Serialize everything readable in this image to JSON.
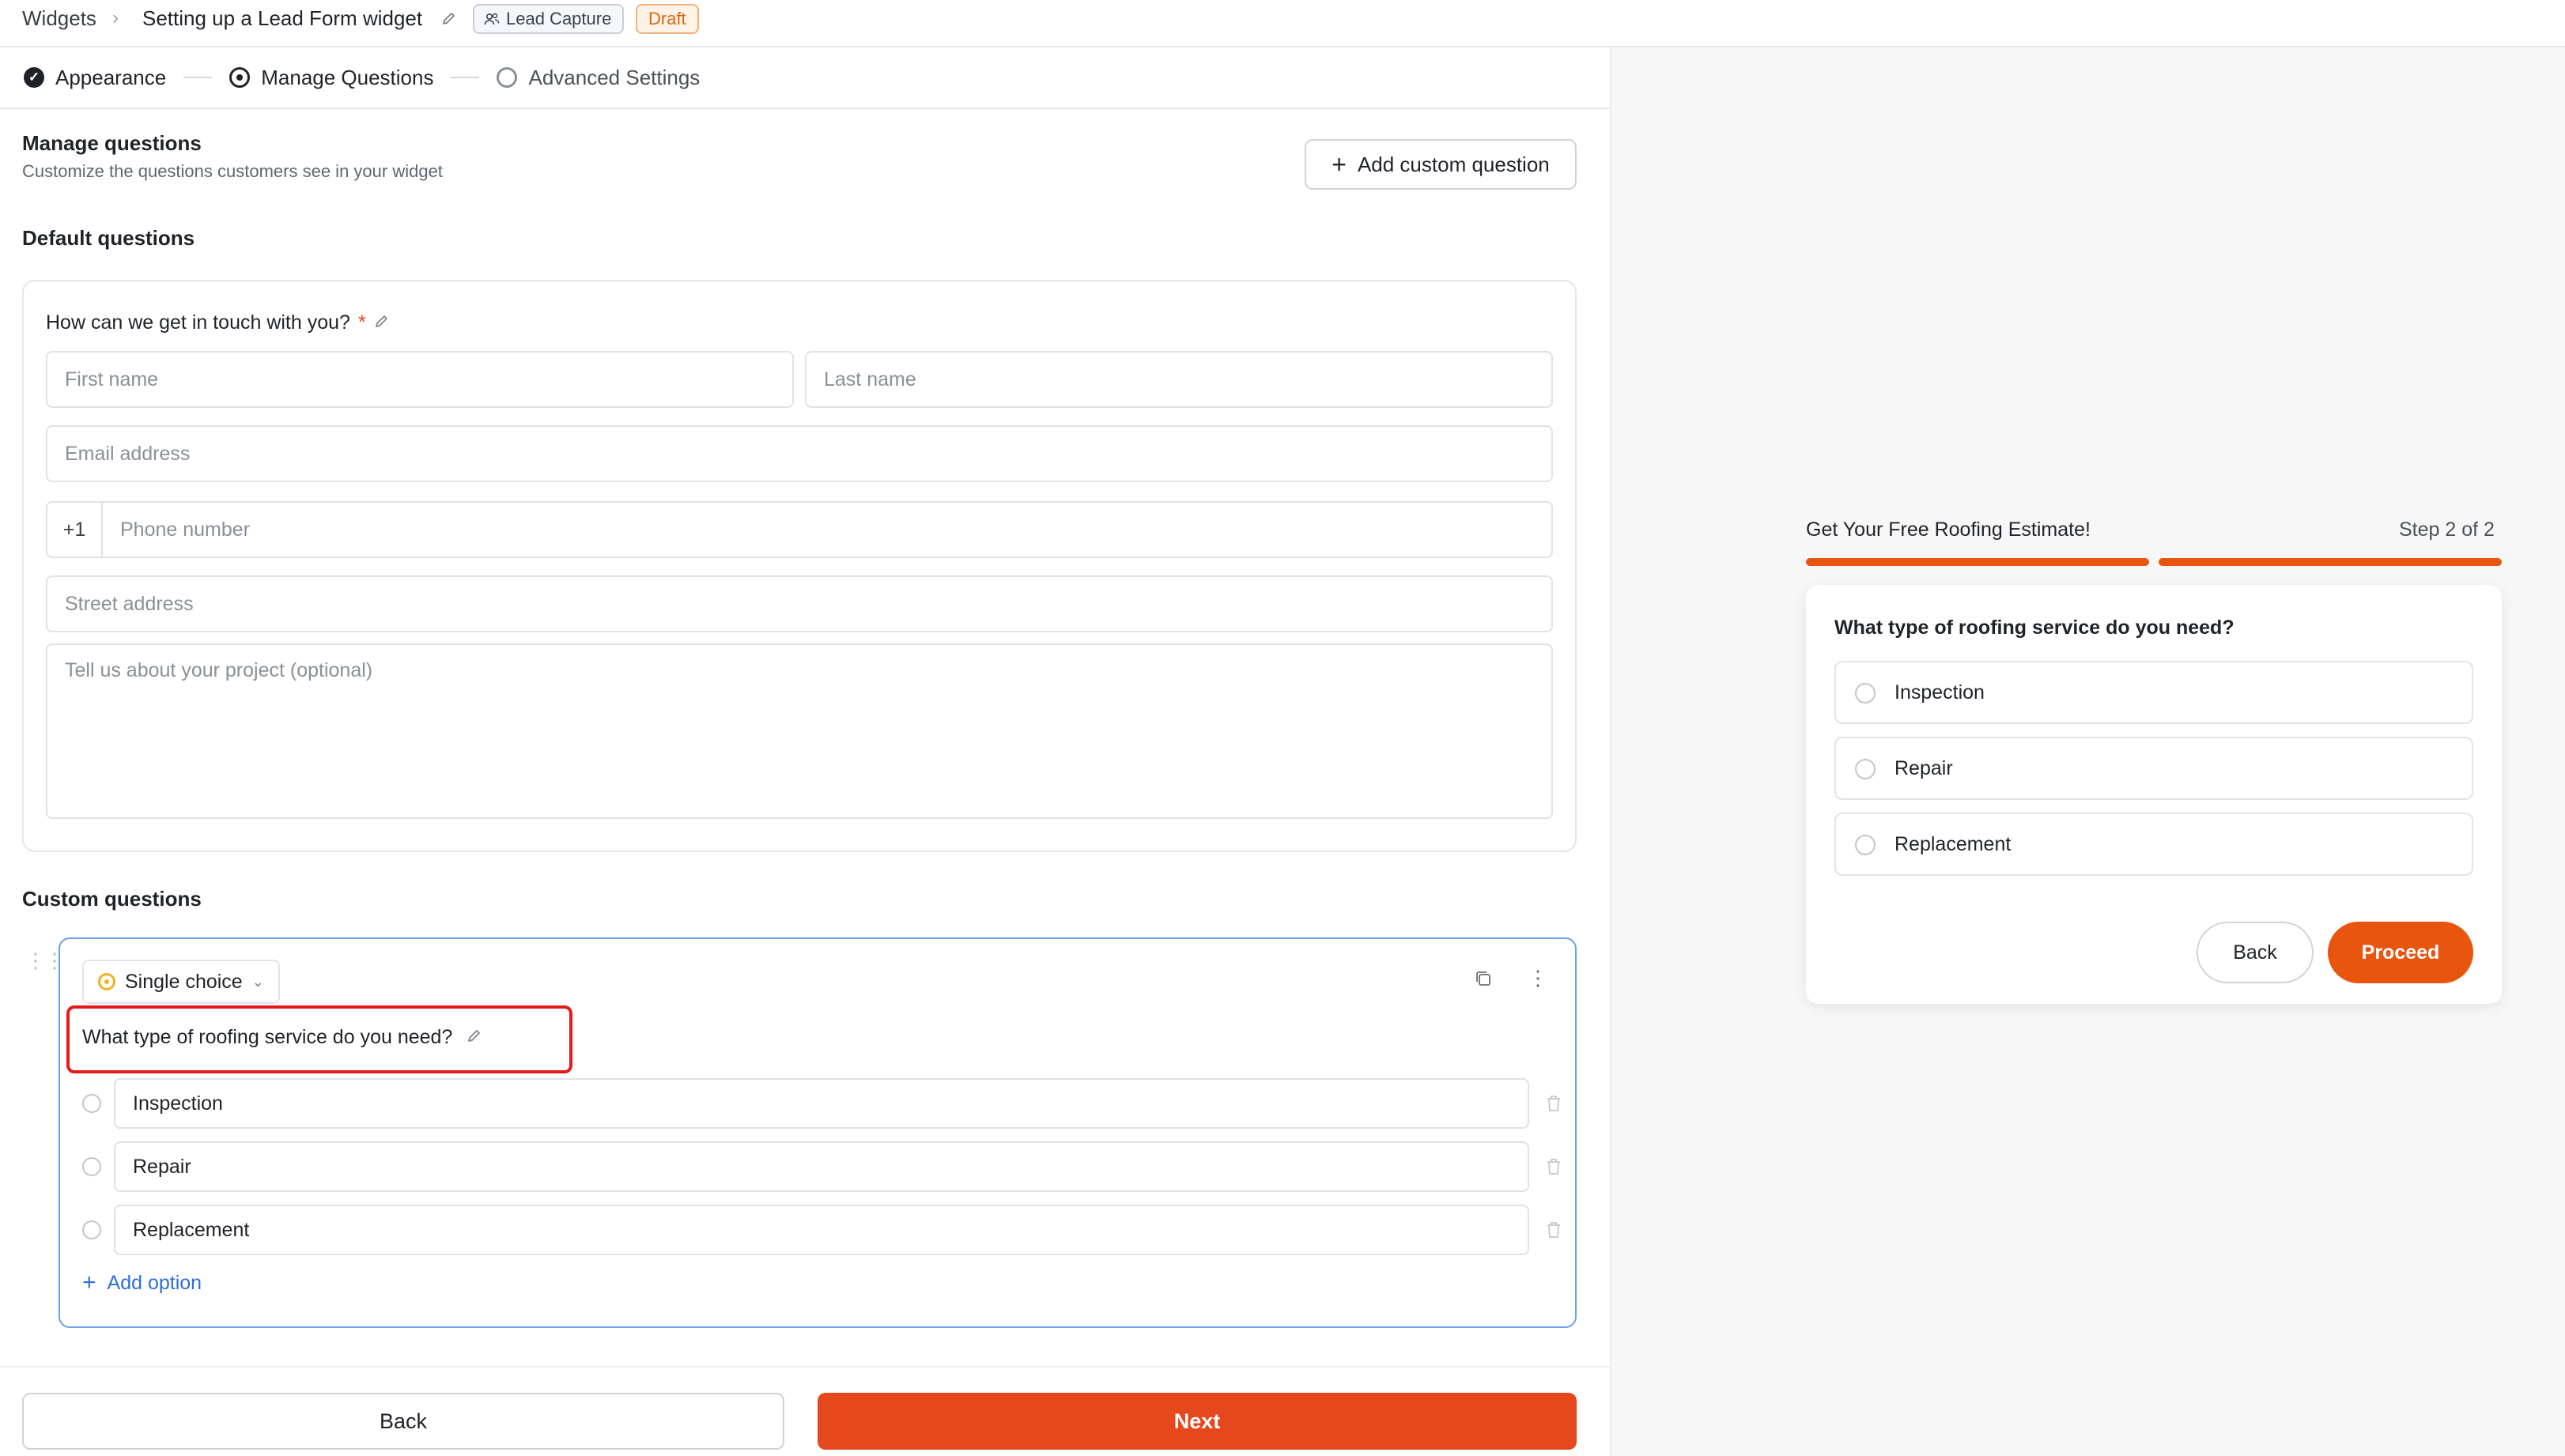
{
  "header": {
    "breadcrumb_root": "Widgets",
    "title": "Setting up a Lead Form widget",
    "badge_type": "Lead Capture",
    "badge_status": "Draft"
  },
  "stepper": {
    "steps": [
      {
        "label": "Appearance",
        "state": "done"
      },
      {
        "label": "Manage Questions",
        "state": "current"
      },
      {
        "label": "Advanced Settings",
        "state": "todo"
      }
    ]
  },
  "manage": {
    "title": "Manage questions",
    "subtitle": "Customize the questions customers see in your widget",
    "add_custom_label": "Add custom question"
  },
  "default_questions": {
    "heading": "Default questions",
    "question": "How can we get in touch with you?",
    "required_mark": "*",
    "placeholders": {
      "first_name": "First name",
      "last_name": "Last name",
      "email": "Email address",
      "phone_prefix": "+1",
      "phone": "Phone number",
      "street": "Street address",
      "project": "Tell us about your project (optional)"
    }
  },
  "custom_questions": {
    "heading": "Custom questions",
    "type_label": "Single choice",
    "question": "What type of roofing service do you need?",
    "options": [
      "Inspection",
      "Repair",
      "Replacement"
    ],
    "add_option_label": "Add option"
  },
  "footer": {
    "back_label": "Back",
    "next_label": "Next"
  },
  "preview": {
    "title": "Get Your Free Roofing Estimate!",
    "step_text": "Step 2 of 2",
    "progress_segments_filled": 2,
    "progress_segments_total": 2,
    "question": "What type of roofing service do you need?",
    "options": [
      "Inspection",
      "Repair",
      "Replacement"
    ],
    "back_label": "Back",
    "proceed_label": "Proceed"
  },
  "colors": {
    "accent": "#e5481c",
    "link": "#2e6fd8",
    "highlight": "#e51b1b",
    "draft": "#d9650f"
  }
}
